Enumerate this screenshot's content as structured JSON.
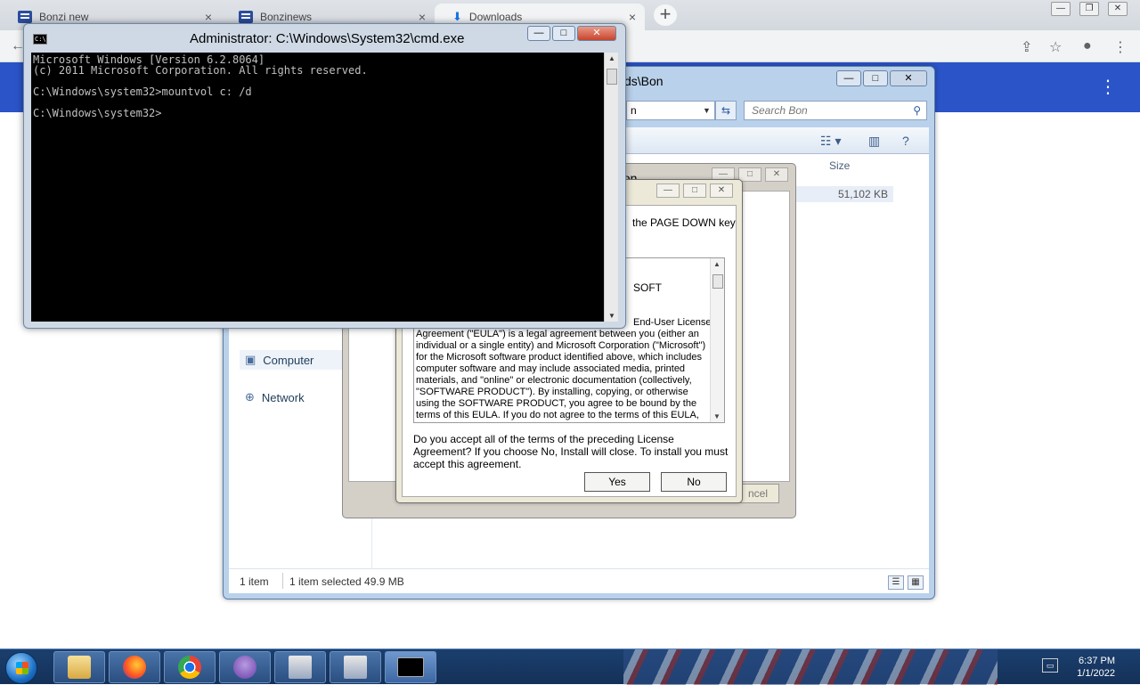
{
  "browser": {
    "tabs": [
      {
        "title": "Bonzi new",
        "close": "×"
      },
      {
        "title": "Bonzinews",
        "close": "×"
      },
      {
        "title": "Downloads",
        "close": "×"
      }
    ],
    "new_tab": "+",
    "win_min": "—",
    "win_max": "❐",
    "win_close": "✕"
  },
  "explorer": {
    "title": "ds\\Bon",
    "address_partial": "n",
    "search_placeholder": "Search Bon",
    "column_size": "Size",
    "file_size": "51,102 KB",
    "nav_computer": "Computer",
    "nav_network": "Network",
    "status_items": "1 item",
    "status_selected": "1 item selected  49.9 MB"
  },
  "installer_back": {
    "title_partial": "ation",
    "cancel_partial": "ncel"
  },
  "eula": {
    "instruction_partial": "the PAGE DOWN key",
    "soft_partial": "SOFT",
    "text_first_line": "End-User License",
    "text": "Agreement (\"EULA\") is a legal agreement between you (either an individual or a single entity) and Microsoft Corporation (\"Microsoft\") for the Microsoft software product identified above, which includes computer software and may include associated media, printed materials, and \"online\" or electronic documentation (collectively, \"SOFTWARE PRODUCT\"). By installing, copying, or otherwise using the SOFTWARE PRODUCT, you agree to be bound by the terms of this EULA. If you do not agree to the terms of this EULA, you may not",
    "question": "Do you accept all of the terms of the preceding License Agreement? If you choose No, Install will close. To install you must accept this agreement.",
    "yes_label": "Yes",
    "no_label": "No"
  },
  "cmd": {
    "title": "Administrator: C:\\Windows\\System32\\cmd.exe",
    "line1": "Microsoft Windows [Version 6.2.8064]",
    "line2": "(c) 2011 Microsoft Corporation. All rights reserved.",
    "line3": "C:\\Windows\\system32>mountvol c: /d",
    "line4": "C:\\Windows\\system32>"
  },
  "taskbar": {
    "time": "6:37 PM",
    "date": "1/1/2022"
  },
  "colors": {
    "page_header_blue": "#2a54c8",
    "cmd_background": "#000000",
    "cmd_text": "#c0c0c0",
    "taskbar": "#1b3f6e"
  }
}
